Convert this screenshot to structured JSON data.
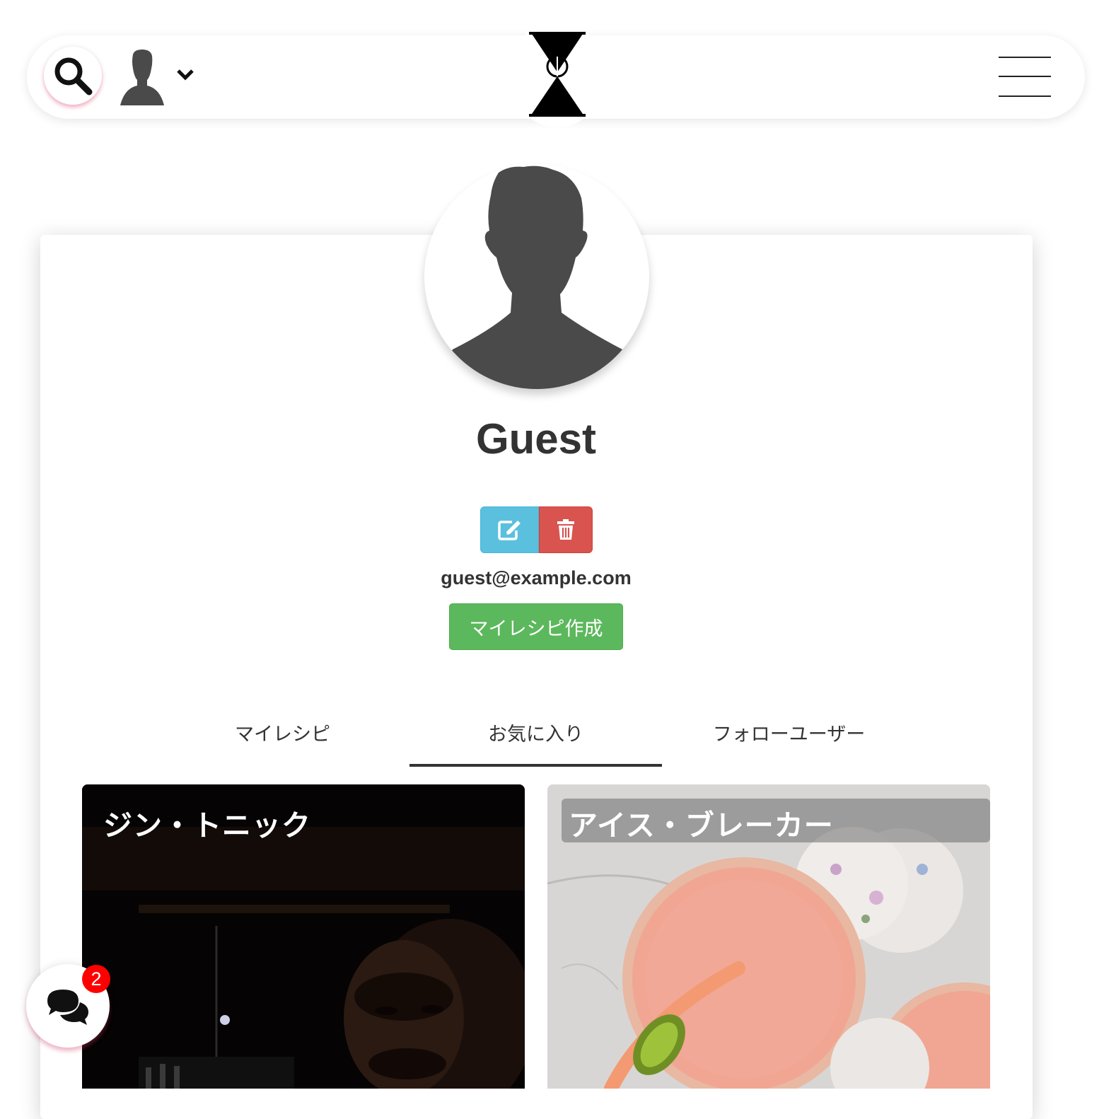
{
  "header": {
    "search_icon": "search-icon",
    "user_icon": "user-silhouette-icon",
    "dropdown_icon": "chevron-down-icon",
    "logo_icon": "hourglass-logo",
    "menu_icon": "hamburger-icon"
  },
  "profile": {
    "name": "Guest",
    "email": "guest@example.com",
    "edit_icon": "edit-icon",
    "delete_icon": "trash-icon",
    "create_label": "マイレシピ作成"
  },
  "tabs": [
    {
      "label": "マイレシピ",
      "active": false
    },
    {
      "label": "お気に入り",
      "active": true
    },
    {
      "label": "フォローユーザー",
      "active": false
    }
  ],
  "recipes": [
    {
      "title": "ジン・トニック"
    },
    {
      "title": "アイス・ブレーカー"
    }
  ],
  "chat": {
    "icon": "chat-bubbles-icon",
    "badge_count": "2"
  },
  "colors": {
    "info": "#5bc0de",
    "danger": "#d9534f",
    "success": "#5cb85c",
    "badge": "#ff0000"
  }
}
